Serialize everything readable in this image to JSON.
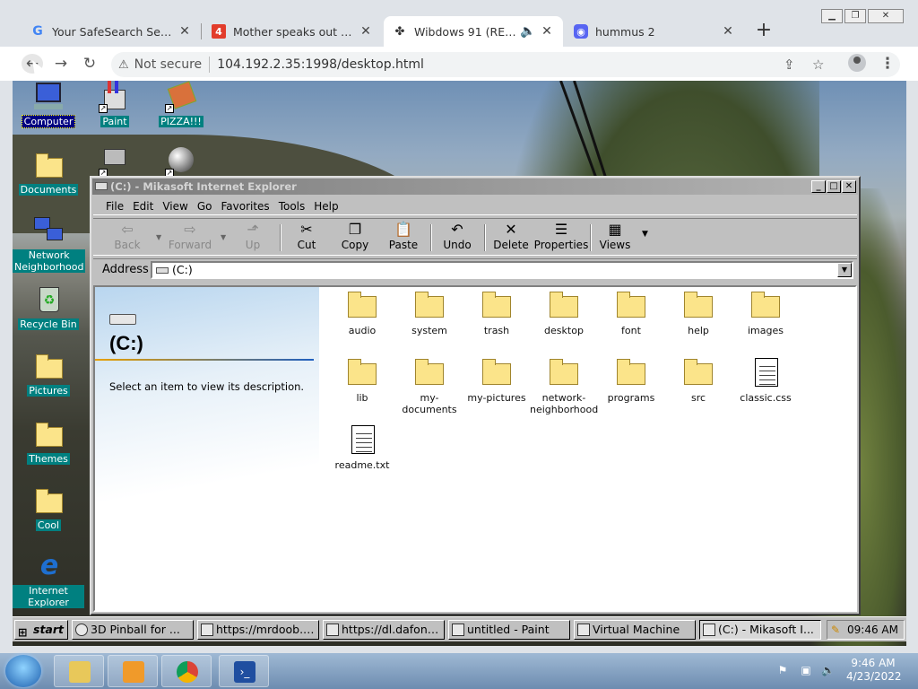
{
  "browser": {
    "tabs": [
      {
        "label": "Your SafeSearch Setting",
        "favicon": "google-icon",
        "color": "#4285f4"
      },
      {
        "label": "Mother speaks out after p",
        "favicon": "news-4-icon",
        "color": "#e23c2b",
        "glyph": "4"
      },
      {
        "label": "Wibdows 91 (REL5)",
        "favicon": "windows91-icon",
        "active": true
      },
      {
        "label": "hummus 2",
        "favicon": "discord-icon",
        "color": "#5865f2"
      }
    ],
    "new_tab": "+",
    "security": "Not secure",
    "url": "104.192.2.35:1998/desktop.html"
  },
  "desktop_icons": [
    {
      "label": "Computer",
      "icon": "computer-icon",
      "selected": true
    },
    {
      "label": "Paint",
      "icon": "paint-icon"
    },
    {
      "label": "PIZZA!!!",
      "icon": "pizza-icon"
    },
    {
      "label": "Documents",
      "icon": "folder-icon"
    },
    {
      "label": "Network Neighborhood",
      "icon": "network-icon"
    },
    {
      "label": "Recycle Bin",
      "icon": "recycle-bin-icon"
    },
    {
      "label": "Pictures",
      "icon": "folder-icon"
    },
    {
      "label": "Themes",
      "icon": "folder-icon"
    },
    {
      "label": "Cool",
      "icon": "folder-icon"
    },
    {
      "label": "Internet Explorer",
      "icon": "internet-explorer-icon"
    }
  ],
  "explorer": {
    "title": "(C:) - Mikasoft Internet Explorer",
    "menu": [
      "File",
      "Edit",
      "View",
      "Go",
      "Favorites",
      "Tools",
      "Help"
    ],
    "toolbar": [
      {
        "label": "Back",
        "icon": "back-arrow-icon",
        "glyph": "⇦",
        "disabled": true
      },
      {
        "label": "Forward",
        "icon": "forward-arrow-icon",
        "glyph": "⇨",
        "disabled": true
      },
      {
        "label": "Up",
        "icon": "up-folder-icon",
        "glyph": "⬏",
        "disabled": true
      },
      {
        "label": "Cut",
        "icon": "scissors-icon",
        "glyph": "✂"
      },
      {
        "label": "Copy",
        "icon": "copy-icon",
        "glyph": "❐"
      },
      {
        "label": "Paste",
        "icon": "paste-icon",
        "glyph": "📋"
      },
      {
        "label": "Undo",
        "icon": "undo-icon",
        "glyph": "↶"
      },
      {
        "label": "Delete",
        "icon": "delete-icon",
        "glyph": "✕"
      },
      {
        "label": "Properties",
        "icon": "properties-icon",
        "glyph": "☰"
      },
      {
        "label": "Views",
        "icon": "views-icon",
        "glyph": "▦"
      }
    ],
    "address_label": "Address",
    "address_value": "(C:)",
    "info_title": "(C:)",
    "info_desc": "Select an item to view its description.",
    "files": [
      {
        "name": "audio",
        "type": "folder"
      },
      {
        "name": "system",
        "type": "folder"
      },
      {
        "name": "trash",
        "type": "folder"
      },
      {
        "name": "desktop",
        "type": "folder"
      },
      {
        "name": "font",
        "type": "folder"
      },
      {
        "name": "help",
        "type": "folder"
      },
      {
        "name": "images",
        "type": "folder"
      },
      {
        "name": "lib",
        "type": "folder"
      },
      {
        "name": "my-documents",
        "type": "folder"
      },
      {
        "name": "my-pictures",
        "type": "folder"
      },
      {
        "name": "network-neighborhood",
        "type": "folder"
      },
      {
        "name": "programs",
        "type": "folder"
      },
      {
        "name": "src",
        "type": "folder"
      },
      {
        "name": "classic.css",
        "type": "file"
      },
      {
        "name": "readme.txt",
        "type": "file"
      }
    ]
  },
  "w91_taskbar": {
    "start": "start",
    "buttons": [
      "3D Pinball for ...",
      "https://mrdoob.c...",
      "https://dl.dafont....",
      "untitled - Paint",
      "Virtual Machine",
      "(C:) - Mikasoft I..."
    ],
    "clock": "09:46 AM"
  },
  "win7": {
    "time": "9:46 AM",
    "date": "4/23/2022"
  }
}
